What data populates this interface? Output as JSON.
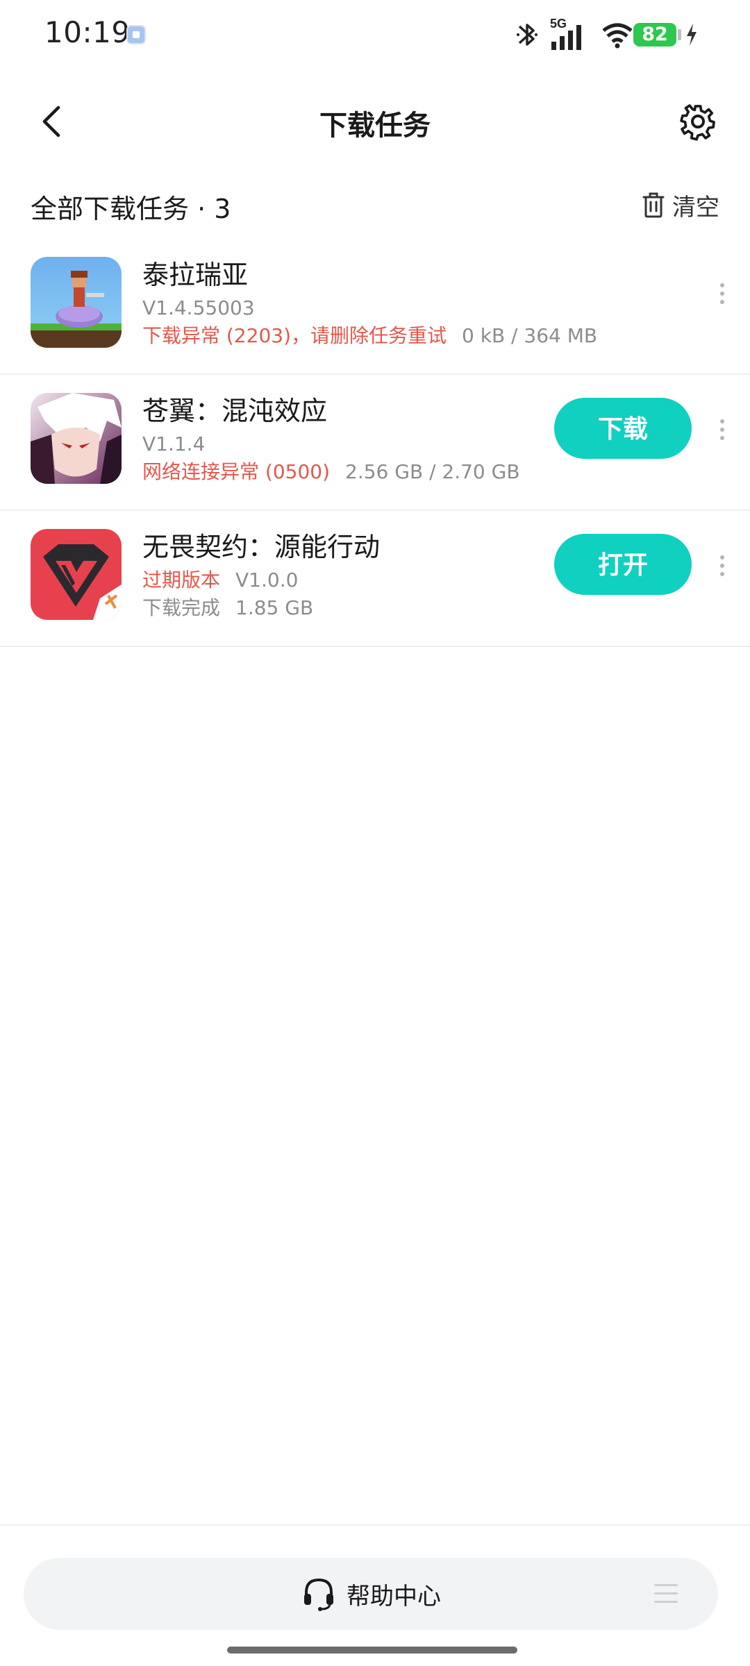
{
  "status_bar": {
    "time": "10:19",
    "network": "5G",
    "battery": "82"
  },
  "header": {
    "title": "下载任务"
  },
  "section": {
    "title": "全部下载任务 · 3",
    "clear_label": "清空"
  },
  "tasks": [
    {
      "name": "泰拉瑞亚",
      "version": "V1.4.55003",
      "status": "下载异常 (2203)，请删除任务重试",
      "progress": "0 kB / 364 MB",
      "action": ""
    },
    {
      "name": "苍翼：混沌效应",
      "version": "V1.1.4",
      "status": "网络连接异常 (0500)",
      "progress": "2.56 GB / 2.70 GB",
      "action": "下载"
    },
    {
      "name": "无畏契约：源能行动",
      "version_tag": "过期版本",
      "version": "V1.0.0",
      "status": "下载完成",
      "progress": "1.85 GB",
      "action": "打开"
    }
  ],
  "bottom": {
    "help_label": "帮助中心"
  },
  "colors": {
    "accent": "#10d0c0",
    "error": "#e5574b",
    "battery": "#2dc84d"
  }
}
